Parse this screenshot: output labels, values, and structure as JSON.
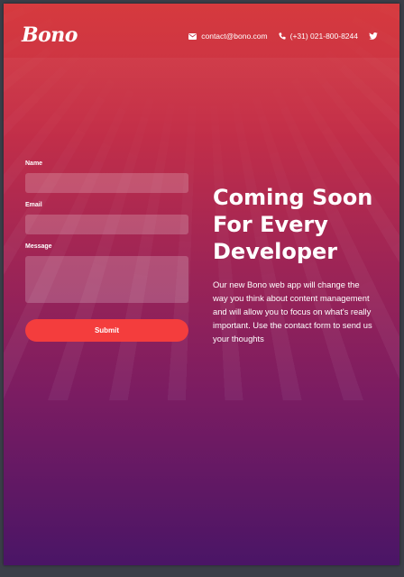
{
  "brand": {
    "logo": "Bono"
  },
  "header": {
    "email": "contact@bono.com",
    "phone": "(+31) 021-800-8244",
    "icons": [
      "envelope-icon",
      "phone-icon",
      "twitter-icon"
    ]
  },
  "form": {
    "name_label": "Name",
    "email_label": "Email",
    "message_label": "Message",
    "submit_label": "Submit"
  },
  "hero": {
    "headline_lines": [
      "Coming Soon",
      "For Every",
      "Developer"
    ],
    "description": "Our new Bono web app will change the way you think about content management and will allow you to focus on what's really important. Use the contact form to send us your thoughts"
  },
  "colors": {
    "gradient_top": "#d63a3e",
    "gradient_bottom": "#4a1566",
    "submit": "#f43d3d",
    "frame": "#3b3f48"
  }
}
